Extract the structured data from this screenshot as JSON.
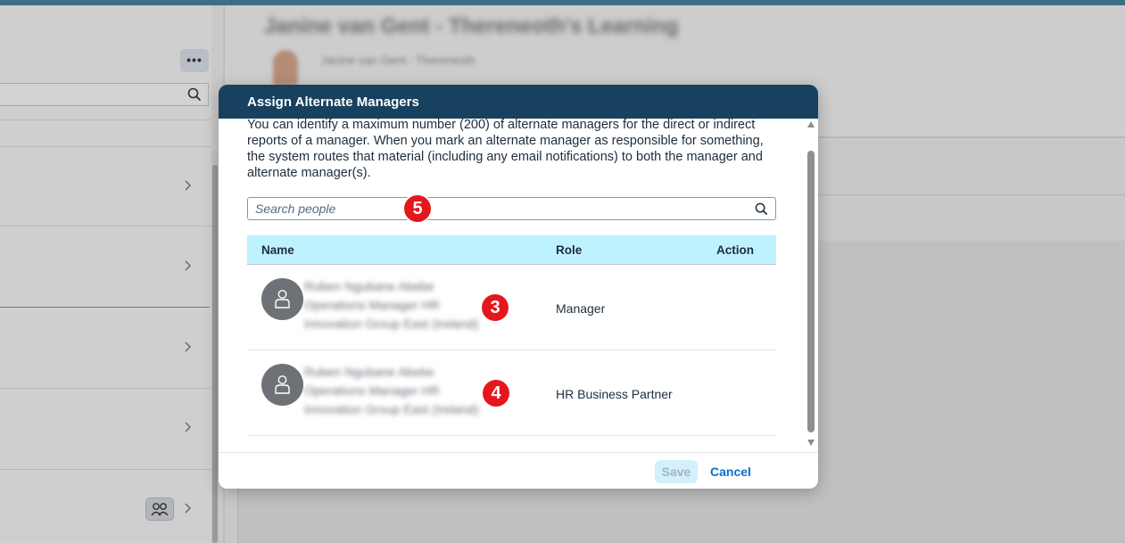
{
  "background": {
    "page_title": "Janine van Gent - Thereneoth's Learning",
    "subtitle": "Janine van Gent - Thereneoth"
  },
  "dialog": {
    "title": "Assign Alternate Managers",
    "intro": "You can identify a maximum number (200) of alternate managers for the direct or indirect reports of a manager. When you mark an alternate manager as responsible for something, the system routes that material (including any email notifications) to both the manager and alternate manager(s).",
    "search": {
      "placeholder": "Search people"
    },
    "table": {
      "columns": {
        "name": "Name",
        "role": "Role",
        "action": "Action"
      },
      "rows": [
        {
          "name_line1": "Ruben Ngubane Abebe",
          "name_line2": "Operations Manager HR",
          "name_line3": "Innovation Group East (Ireland)",
          "role": "Manager"
        },
        {
          "name_line1": "Ruben Ngubane Abebe",
          "name_line2": "Operations Manager HR",
          "name_line3": "Innovation Group East (Ireland)",
          "role": "HR Business Partner"
        }
      ]
    },
    "footer": {
      "save_label": "Save",
      "cancel_label": "Cancel"
    }
  },
  "annotations": {
    "badge_search": "5",
    "badge_row1": "3",
    "badge_row2": "4"
  },
  "colors": {
    "header_bg": "#17415e",
    "table_header_bg": "#bff2ff",
    "badge": "#e5171c",
    "link": "#0a6ed1",
    "save_disabled_bg": "#d3f0fb"
  }
}
